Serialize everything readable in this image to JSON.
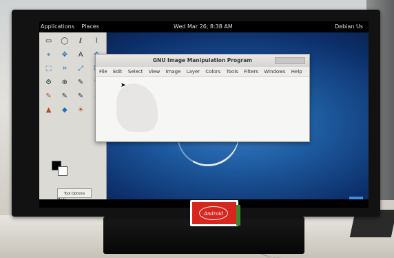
{
  "scene": {
    "description_colors": {
      "screen": "#1e5ba0",
      "bezel": "#121212",
      "sticker": "#d8261f"
    }
  },
  "topbar": {
    "menu_items": [
      "Applications",
      "Places"
    ],
    "clock": "Wed Mar 26, 8:38 AM",
    "user": "Debian Us"
  },
  "gimp": {
    "title": "GNU Image Manipulation Program",
    "menu": [
      "File",
      "Edit",
      "Select",
      "View",
      "Image",
      "Layer",
      "Colors",
      "Tools",
      "Filters",
      "Windows",
      "Help"
    ]
  },
  "toolbox": {
    "tool_icons": [
      "▭",
      "◯",
      "ℓ",
      "⌇",
      "⌖",
      "✥",
      "A",
      "✥",
      "⬚",
      "⌗",
      "⤢",
      "⌘",
      "⚙",
      "⊕",
      "✎",
      "✎",
      "✎",
      "✎",
      "✎",
      "⌀",
      "▲",
      "◆",
      "☀",
      "⚱"
    ],
    "tool_options_tab": "Tool Options",
    "mode_label": "Mode"
  },
  "sticker": {
    "logo_text": "Android"
  }
}
